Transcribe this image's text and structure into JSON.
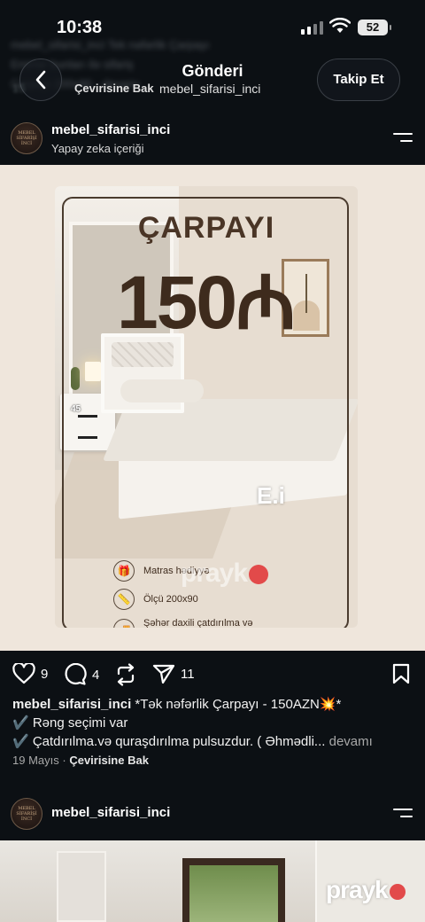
{
  "status_bar": {
    "time": "10:38",
    "battery": "52"
  },
  "background_blur": {
    "line1": "mebel_sifarisi_inci Tek nəfərlik Çarpayı",
    "line2": "Emirlər bunları ilə sifariş",
    "line3": "Çarpayı 200x90 - devamı",
    "line4": "15 Mayıs"
  },
  "nav": {
    "title": "Gönderi",
    "subtitle": "mebel_sifarisi_inci",
    "left_faded": "15",
    "left_translate": "Çevirisine Bak",
    "follow_label": "Takip Et"
  },
  "post": {
    "username": "mebel_sifarisi_inci",
    "subline": "Yapay zeka içeriği",
    "avatar_text": [
      "MEBEL",
      "SİFARİŞİ",
      "İNCİ"
    ],
    "image": {
      "title": "ÇARPAYI",
      "price": "150₼",
      "nightstand_label": "45",
      "brand_mark": "E.i",
      "features": [
        {
          "icon": "gift-icon",
          "glyph": "🎁",
          "text": "Matras hədiyyə"
        },
        {
          "icon": "ruler-icon",
          "glyph": "📏",
          "text": "Ölçü 200x90"
        },
        {
          "icon": "truck-icon",
          "glyph": "🚚",
          "text": "Şəhər daxili çatdırılma və quraşdırılma pulsuz"
        }
      ],
      "watermark": "prayk"
    },
    "actions": {
      "likes": "9",
      "comments": "4",
      "shares": "11"
    },
    "caption": {
      "username": "mebel_sifarisi_inci",
      "line1": "*Tək nəfərlik Çarpayı - 150AZN💥*",
      "line2": "✔️ Rəng seçimi var",
      "line3": "✔️ Çatdırılma.və quraşdırılma pulsuzdur. ( Əhmədli...",
      "more": "devamı"
    },
    "meta": {
      "date": "19 Mayıs",
      "translate": "Çevirisine Bak"
    }
  },
  "post2": {
    "username": "mebel_sifarisi_inci",
    "watermark": "prayk"
  },
  "colors": {
    "background": "#0c1014",
    "poster_brown": "#3e2b1d",
    "watermark_dot": "#e24a4a"
  }
}
